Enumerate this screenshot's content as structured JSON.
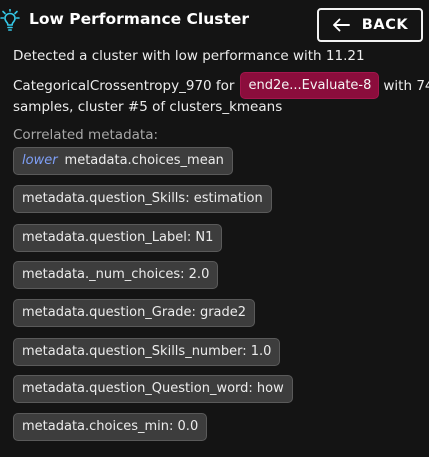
{
  "header": {
    "title": "Low Performance Cluster",
    "back_label": "BACK"
  },
  "description": {
    "line1": "Detected a cluster with low performance with 11.21",
    "line2_prefix": "CategoricalCrossentropy_970 for",
    "experiment_tag": "end2e...Evaluate-8",
    "line2_suffix": "with 74",
    "line3": "samples, cluster #5 of clusters_kmeans"
  },
  "correlated": {
    "label": "Correlated metadata:",
    "direction": "lower",
    "items": [
      "metadata.choices_mean",
      "metadata.question_Skills: estimation",
      "metadata.question_Label: N1",
      "metadata._num_choices: 2.0",
      "metadata.question_Grade: grade2",
      "metadata.question_Skills_number: 1.0",
      "metadata.question_Question_word: how",
      "metadata.choices_min: 0.0"
    ]
  },
  "colors": {
    "background": "#141414",
    "experiment_tag": "#8b0d3c",
    "chip": "#3d3d3d",
    "direction_text": "#7e9ff6",
    "icon_accent": "#35c7e6"
  }
}
